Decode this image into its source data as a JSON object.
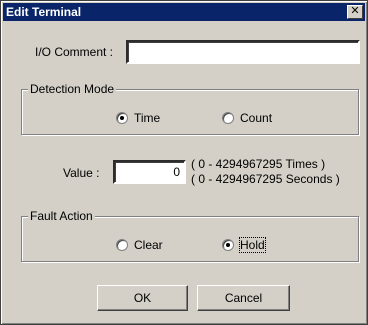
{
  "window": {
    "title": "Edit Terminal",
    "close_glyph": "✕"
  },
  "io_comment": {
    "label": "I/O Comment :",
    "value": ""
  },
  "detection_mode": {
    "legend": "Detection Mode",
    "options": [
      {
        "label": "Time",
        "checked": true
      },
      {
        "label": "Count",
        "checked": false
      }
    ]
  },
  "value_field": {
    "label": "Value :",
    "value": "0",
    "range_times": "( 0 - 4294967295 Times )",
    "range_seconds": "( 0 - 4294967295 Seconds )"
  },
  "fault_action": {
    "legend": "Fault Action",
    "options": [
      {
        "label": "Clear",
        "checked": false
      },
      {
        "label": "Hold",
        "checked": true
      }
    ]
  },
  "buttons": {
    "ok": "OK",
    "cancel": "Cancel"
  }
}
